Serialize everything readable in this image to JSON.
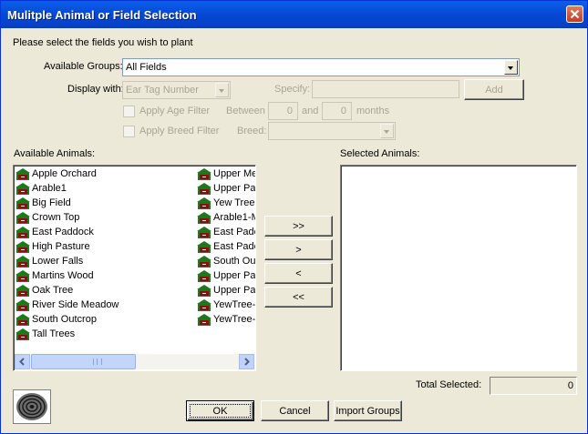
{
  "window": {
    "title": "Mulitple Animal or Field Selection"
  },
  "prompt": "Please select the fields you wish to plant",
  "groups": {
    "label": "Available Groups:",
    "value": "All Fields"
  },
  "display": {
    "label": "Display with:",
    "value": "Ear Tag Number",
    "specify_label": "Specify:",
    "specify_value": "",
    "add_label": "Add"
  },
  "age_filter": {
    "label": "Apply Age Filter",
    "between_label": "Between",
    "from": "0",
    "and_label": "and",
    "to": "0",
    "months_label": "months"
  },
  "breed_filter": {
    "label": "Apply Breed Filter",
    "breed_label": "Breed:",
    "breed_value": ""
  },
  "available": {
    "label": "Available Animals:",
    "col1": [
      "Apple Orchard",
      "Arable1",
      "Big Field",
      "Crown Top",
      "East Paddock",
      "High Pasture",
      "Lower Falls",
      "Martins Wood",
      "Oak Tree",
      "River Side Meadow",
      "South Outcrop",
      "Tall Trees"
    ],
    "col2": [
      "Upper Me",
      "Upper Pa",
      "Yew Tree",
      "Arable1-M",
      "East Padc",
      "East Padc",
      "South Ou",
      "Upper Pa",
      "Upper Pa",
      "YewTree-",
      "YewTree-"
    ]
  },
  "move": {
    "add_all": ">>",
    "add": ">",
    "remove": "<",
    "remove_all": "<<"
  },
  "selected": {
    "label": "Selected Animals:",
    "items": []
  },
  "total": {
    "label": "Total Selected:",
    "value": "0"
  },
  "buttons": {
    "ok": "OK",
    "cancel": "Cancel",
    "import": "Import Groups"
  },
  "icons": {
    "field": "field-icon",
    "logo": "logo-icon"
  },
  "colors": {
    "title_bar": "#0548d4",
    "field_icon_roof": "#1c7a1c",
    "field_icon_body": "#8a1010"
  }
}
